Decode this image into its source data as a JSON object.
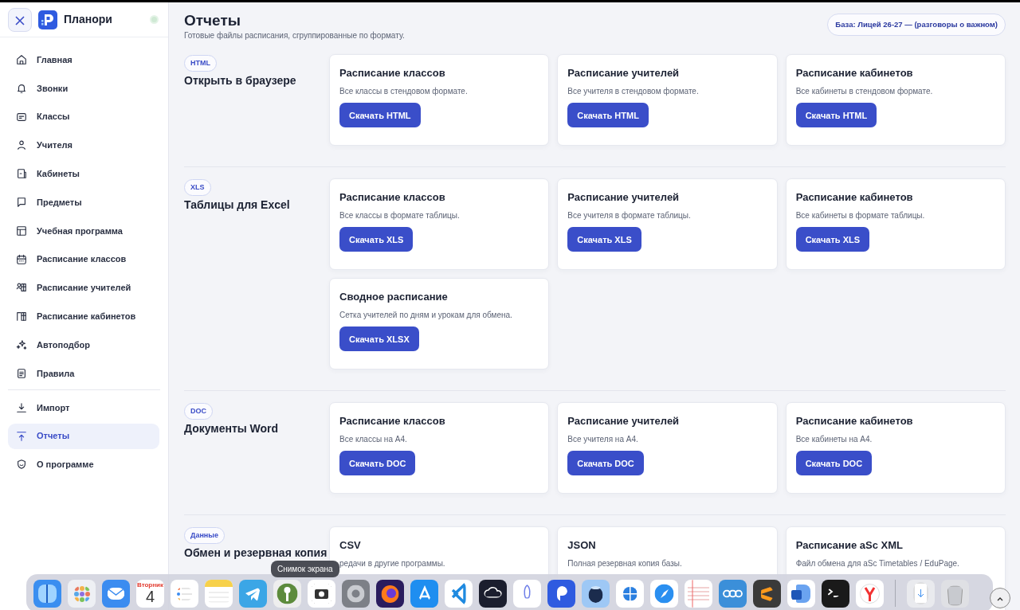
{
  "sidebar": {
    "app_name": "Планори",
    "groups": [
      {
        "items": [
          {
            "label": "Главная",
            "selected": false
          },
          {
            "label": "Звонки",
            "selected": false
          },
          {
            "label": "Классы",
            "selected": false
          },
          {
            "label": "Учителя",
            "selected": false
          },
          {
            "label": "Кабинеты",
            "selected": false
          },
          {
            "label": "Предметы",
            "selected": false
          },
          {
            "label": "Учебная программа",
            "selected": false
          },
          {
            "label": "Расписание классов",
            "selected": false
          },
          {
            "label": "Расписание учителей",
            "selected": false
          },
          {
            "label": "Расписание кабинетов",
            "selected": false
          },
          {
            "label": "Автоподбор",
            "selected": false
          },
          {
            "label": "Правила",
            "selected": false
          }
        ]
      },
      {
        "items": [
          {
            "label": "Импорт",
            "selected": false
          },
          {
            "label": "Отчеты",
            "selected": true
          },
          {
            "label": "О программе",
            "selected": false
          }
        ]
      }
    ]
  },
  "header": {
    "title": "Отчеты",
    "subtitle": "Готовые файлы расписания, сгруппированные по формату.",
    "base_badge": "База: Лицей 26-27 — (разговоры о важном)"
  },
  "sections": [
    {
      "badge": "HTML",
      "title": "Открыть в браузере",
      "cards": [
        {
          "title": "Расписание классов",
          "description": "Все классы в стендовом формате.",
          "button": "Скачать HTML"
        },
        {
          "title": "Расписание учителей",
          "description": "Все учителя в стендовом формате.",
          "button": "Скачать HTML"
        },
        {
          "title": "Расписание кабинетов",
          "description": "Все кабинеты в стендовом формате.",
          "button": "Скачать HTML"
        }
      ]
    },
    {
      "badge": "XLS",
      "title": "Таблицы для Excel",
      "cards": [
        {
          "title": "Расписание классов",
          "description": "Все классы в формате таблицы.",
          "button": "Скачать XLS"
        },
        {
          "title": "Расписание учителей",
          "description": "Все учителя в формате таблицы.",
          "button": "Скачать XLS"
        },
        {
          "title": "Расписание кабинетов",
          "description": "Все кабинеты в формате таблицы.",
          "button": "Скачать XLS"
        },
        {
          "title": "Сводное расписание",
          "description": "Сетка учителей по дням и урокам для обмена.",
          "button": "Скачать XLSX"
        }
      ]
    },
    {
      "badge": "DOC",
      "title": "Документы Word",
      "cards": [
        {
          "title": "Расписание классов",
          "description": "Все классы на А4.",
          "button": "Скачать DOC"
        },
        {
          "title": "Расписание учителей",
          "description": "Все учителя на А4.",
          "button": "Скачать DOC"
        },
        {
          "title": "Расписание кабинетов",
          "description": "Все кабинеты на А4.",
          "button": "Скачать DOC"
        }
      ]
    },
    {
      "badge": "Данные",
      "title": "Обмен и резервная копия",
      "cards": [
        {
          "title": "CSV",
          "description": "редачи в другие программы."
        },
        {
          "title": "JSON",
          "description": "Полная резервная копия базы."
        },
        {
          "title": "Расписание aSc XML",
          "description": "Файл обмена для aSc Timetables / EduPage."
        }
      ]
    }
  ],
  "dock": {
    "tooltip": "Снимок экрана",
    "calendar_weekday": "Вторник",
    "calendar_day": "4"
  }
}
